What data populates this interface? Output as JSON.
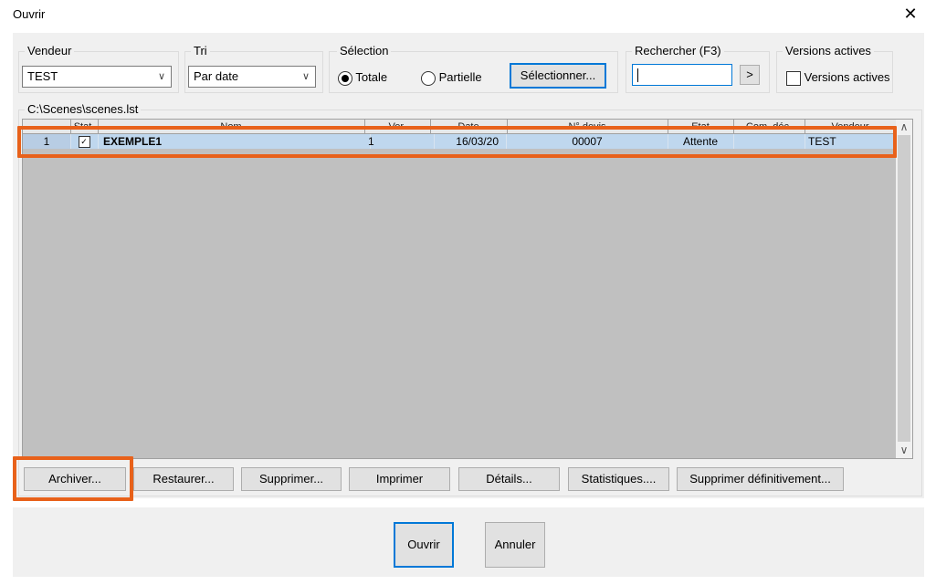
{
  "window": {
    "title": "Ouvrir",
    "close_glyph": "✕"
  },
  "vendeur": {
    "label": "Vendeur",
    "value": "TEST"
  },
  "tri": {
    "label": "Tri",
    "value": "Par date"
  },
  "selection": {
    "label": "Sélection",
    "totale": "Totale",
    "partielle": "Partielle",
    "selected": "Totale",
    "select_button": "Sélectionner..."
  },
  "rechercher": {
    "label": "Rechercher (F3)",
    "value": "",
    "go_button": ">"
  },
  "versions": {
    "label": "Versions actives",
    "checkbox_label": "Versions actives",
    "checked": false
  },
  "file": {
    "path": "C:\\Scenes\\scenes.lst"
  },
  "table": {
    "columns": [
      "",
      "Stat.",
      "Nom",
      "Ver.",
      "Date",
      "N° devis",
      "Etat",
      "Com. déc.",
      "Vendeur"
    ],
    "rows": [
      {
        "index": "1",
        "stat_checked": true,
        "nom": "EXEMPLE1",
        "ver": "1",
        "date": "16/03/20",
        "devis": "00007",
        "etat": "Attente",
        "com": "",
        "vendeur": "TEST"
      }
    ]
  },
  "actions": {
    "archiver": "Archiver...",
    "restaurer": "Restaurer...",
    "supprimer": "Supprimer...",
    "imprimer": "Imprimer",
    "details": "Détails...",
    "statistiques": "Statistiques....",
    "supprimer_def": "Supprimer définitivement..."
  },
  "footer": {
    "ouvrir": "Ouvrir",
    "annuler": "Annuler"
  },
  "colors": {
    "highlight": "#e8611a",
    "selected_row": "#bfd7ee",
    "grid_bg": "#c0c0c0",
    "accent": "#0078d7"
  }
}
